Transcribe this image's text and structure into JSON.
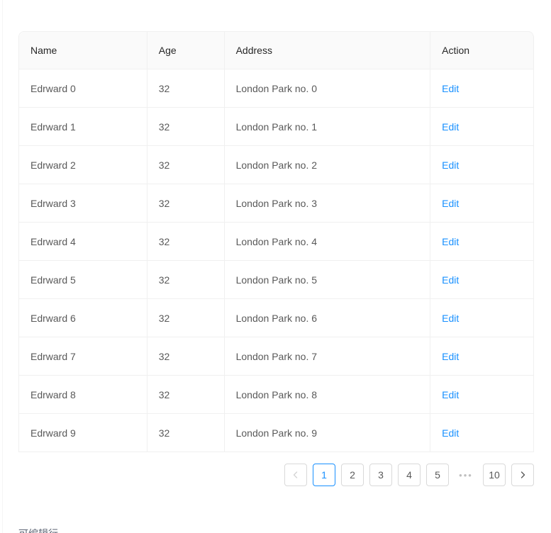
{
  "table": {
    "columns": [
      {
        "key": "name",
        "label": "Name"
      },
      {
        "key": "age",
        "label": "Age"
      },
      {
        "key": "address",
        "label": "Address"
      },
      {
        "key": "action",
        "label": "Action"
      }
    ],
    "rows": [
      {
        "name": "Edrward 0",
        "age": "32",
        "address": "London Park no. 0",
        "action": "Edit"
      },
      {
        "name": "Edrward 1",
        "age": "32",
        "address": "London Park no. 1",
        "action": "Edit"
      },
      {
        "name": "Edrward 2",
        "age": "32",
        "address": "London Park no. 2",
        "action": "Edit"
      },
      {
        "name": "Edrward 3",
        "age": "32",
        "address": "London Park no. 3",
        "action": "Edit"
      },
      {
        "name": "Edrward 4",
        "age": "32",
        "address": "London Park no. 4",
        "action": "Edit"
      },
      {
        "name": "Edrward 5",
        "age": "32",
        "address": "London Park no. 5",
        "action": "Edit"
      },
      {
        "name": "Edrward 6",
        "age": "32",
        "address": "London Park no. 6",
        "action": "Edit"
      },
      {
        "name": "Edrward 7",
        "age": "32",
        "address": "London Park no. 7",
        "action": "Edit"
      },
      {
        "name": "Edrward 8",
        "age": "32",
        "address": "London Park no. 8",
        "action": "Edit"
      },
      {
        "name": "Edrward 9",
        "age": "32",
        "address": "London Park no. 9",
        "action": "Edit"
      }
    ]
  },
  "pagination": {
    "prev_icon": "chevron-left-icon",
    "next_icon": "chevron-right-icon",
    "prev_disabled": true,
    "next_disabled": false,
    "active_page": "1",
    "pages": [
      "1",
      "2",
      "3",
      "4",
      "5"
    ],
    "ellipsis": "•••",
    "last_page": "10"
  },
  "caption": {
    "text": "可编辑行"
  },
  "colors": {
    "primary": "#1890ff",
    "header_bg": "#fafafa",
    "border": "#f0f0f0",
    "text": "#595959",
    "heading_text": "#262626"
  }
}
